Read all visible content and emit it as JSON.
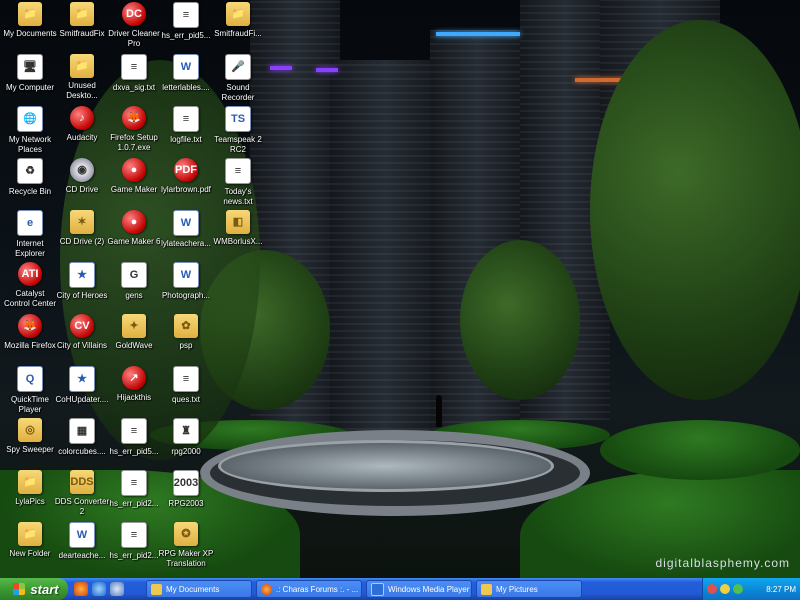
{
  "wallpaper": {
    "brand": "digitalblasphemy.com"
  },
  "icons": [
    {
      "label": "My Documents",
      "glyph": "📁",
      "style": "folder"
    },
    {
      "label": "My Computer",
      "glyph": "🖥",
      "style": "txt"
    },
    {
      "label": "My Network Places",
      "glyph": "🌐",
      "style": "doc"
    },
    {
      "label": "Recycle Bin",
      "glyph": "♻",
      "style": "txt"
    },
    {
      "label": "Internet Explorer",
      "glyph": "e",
      "style": "doc"
    },
    {
      "label": "Catalyst Control Center",
      "glyph": "ATI",
      "style": "red"
    },
    {
      "label": "Mozilla Firefox",
      "glyph": "🦊",
      "style": "red"
    },
    {
      "label": "QuickTime Player",
      "glyph": "Q",
      "style": "doc"
    },
    {
      "label": "Spy Sweeper",
      "glyph": "◎",
      "style": "folder"
    },
    {
      "label": "LylaPics",
      "glyph": "📁",
      "style": "folder"
    },
    {
      "label": "New Folder",
      "glyph": "📁",
      "style": "folder"
    },
    {
      "label": "SmitfraudFix",
      "glyph": "📁",
      "style": "folder"
    },
    {
      "label": "Unused Deskto...",
      "glyph": "📁",
      "style": "folder"
    },
    {
      "label": "Audacity",
      "glyph": "♪",
      "style": "red"
    },
    {
      "label": "CD Drive",
      "glyph": "◉",
      "style": "cd"
    },
    {
      "label": "CD Drive (2)",
      "glyph": "✶",
      "style": "folder"
    },
    {
      "label": "City of Heroes",
      "glyph": "★",
      "style": "doc"
    },
    {
      "label": "City of Villains",
      "glyph": "CV",
      "style": "red"
    },
    {
      "label": "CoHUpdater....",
      "glyph": "★",
      "style": "doc"
    },
    {
      "label": "colorcubes....",
      "glyph": "▦",
      "style": "txt"
    },
    {
      "label": "DDS Converter 2",
      "glyph": "DDS",
      "style": "folder"
    },
    {
      "label": "dearteache...",
      "glyph": "W",
      "style": "doc"
    },
    {
      "label": "Driver Cleaner Pro",
      "glyph": "DC",
      "style": "red"
    },
    {
      "label": "dxva_sig.txt",
      "glyph": "≡",
      "style": "txt"
    },
    {
      "label": "Firefox Setup 1.0.7.exe",
      "glyph": "🦊",
      "style": "red"
    },
    {
      "label": "Game Maker",
      "glyph": "●",
      "style": "red"
    },
    {
      "label": "Game Maker 6",
      "glyph": "●",
      "style": "red"
    },
    {
      "label": "gens",
      "glyph": "G",
      "style": "txt"
    },
    {
      "label": "GoldWave",
      "glyph": "✦",
      "style": "folder"
    },
    {
      "label": "Hijackthis",
      "glyph": "↗",
      "style": "red"
    },
    {
      "label": "hs_err_pid5...",
      "glyph": "≡",
      "style": "txt"
    },
    {
      "label": "hs_err_pid2...",
      "glyph": "≡",
      "style": "txt"
    },
    {
      "label": "hs_err_pid2...",
      "glyph": "≡",
      "style": "txt"
    },
    {
      "label": "hs_err_pid5...",
      "glyph": "≡",
      "style": "txt"
    },
    {
      "label": "letterlables....",
      "glyph": "W",
      "style": "doc"
    },
    {
      "label": "logfile.txt",
      "glyph": "≡",
      "style": "txt"
    },
    {
      "label": "lylarbrown.pdf",
      "glyph": "PDF",
      "style": "red"
    },
    {
      "label": "lylateachera...",
      "glyph": "W",
      "style": "doc"
    },
    {
      "label": "Photograph...",
      "glyph": "W",
      "style": "doc"
    },
    {
      "label": "psp",
      "glyph": "✿",
      "style": "folder"
    },
    {
      "label": "ques.txt",
      "glyph": "≡",
      "style": "txt"
    },
    {
      "label": "rpg2000",
      "glyph": "♜",
      "style": "txt"
    },
    {
      "label": "RPG2003",
      "glyph": "2003",
      "style": "txt"
    },
    {
      "label": "RPG Maker XP Translation",
      "glyph": "✪",
      "style": "folder"
    },
    {
      "label": "SmitfraudFi...",
      "glyph": "📁",
      "style": "folder"
    },
    {
      "label": "Sound Recorder",
      "glyph": "🎤",
      "style": "txt"
    },
    {
      "label": "Teamspeak 2 RC2",
      "glyph": "TS",
      "style": "doc"
    },
    {
      "label": "Today's news.txt",
      "glyph": "≡",
      "style": "txt"
    },
    {
      "label": "WMBorlusX...",
      "glyph": "◧",
      "style": "folder"
    }
  ],
  "taskbar": {
    "start_label": "start",
    "quick_launch": [
      "firefox",
      "internet-explorer",
      "media"
    ],
    "windows": [
      {
        "label": "My Documents",
        "icon": "folder"
      },
      {
        "label": ".: Charas Forums :. - ...",
        "icon": "firefox"
      },
      {
        "label": "Windows Media Player",
        "icon": "media"
      },
      {
        "label": "My Pictures",
        "icon": "folder"
      }
    ],
    "clock": "8:27 PM"
  }
}
